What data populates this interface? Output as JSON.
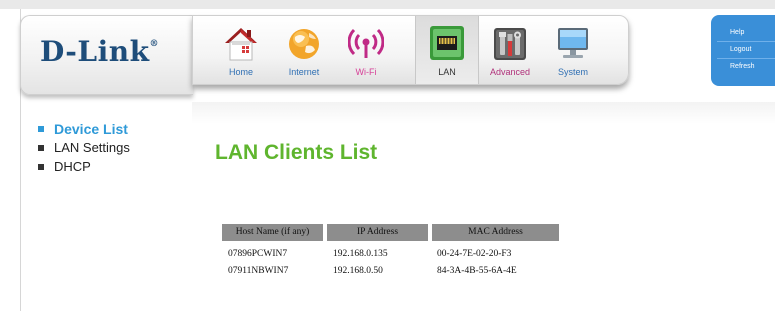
{
  "brand": {
    "logo_text": "D-Link",
    "trademark": "®"
  },
  "nav": {
    "items": [
      {
        "key": "home",
        "label": "Home",
        "icon": "home-icon"
      },
      {
        "key": "internet",
        "label": "Internet",
        "icon": "globe-icon"
      },
      {
        "key": "wifi",
        "label": "Wi-Fi",
        "icon": "wifi-icon"
      },
      {
        "key": "lan",
        "label": "LAN",
        "icon": "lan-icon",
        "active": true
      },
      {
        "key": "advanced",
        "label": "Advanced",
        "icon": "tools-icon"
      },
      {
        "key": "system",
        "label": "System",
        "icon": "computer-icon"
      }
    ]
  },
  "quick_links": {
    "help": "Help",
    "logout": "Logout",
    "refresh": "Refresh"
  },
  "sidebar": {
    "items": [
      {
        "label": "Device List",
        "active": true
      },
      {
        "label": "LAN Settings"
      },
      {
        "label": "DHCP"
      }
    ]
  },
  "main": {
    "title": "LAN Clients List",
    "table": {
      "headers": [
        "Host Name (if any)",
        "IP Address",
        "MAC Address"
      ],
      "rows": [
        [
          "07896PCWIN7",
          "192.168.0.135",
          "00-24-7E-02-20-F3"
        ],
        [
          "07911NBWIN7",
          "192.168.0.50",
          "84-3A-4B-55-6A-4E"
        ]
      ]
    }
  },
  "colors": {
    "brand_blue": "#1e4d7a",
    "accent_blue": "#2f9ad8",
    "title_green": "#5fb52e",
    "quick_panel": "#3a8fd8",
    "table_header": "#8d8d8d"
  }
}
